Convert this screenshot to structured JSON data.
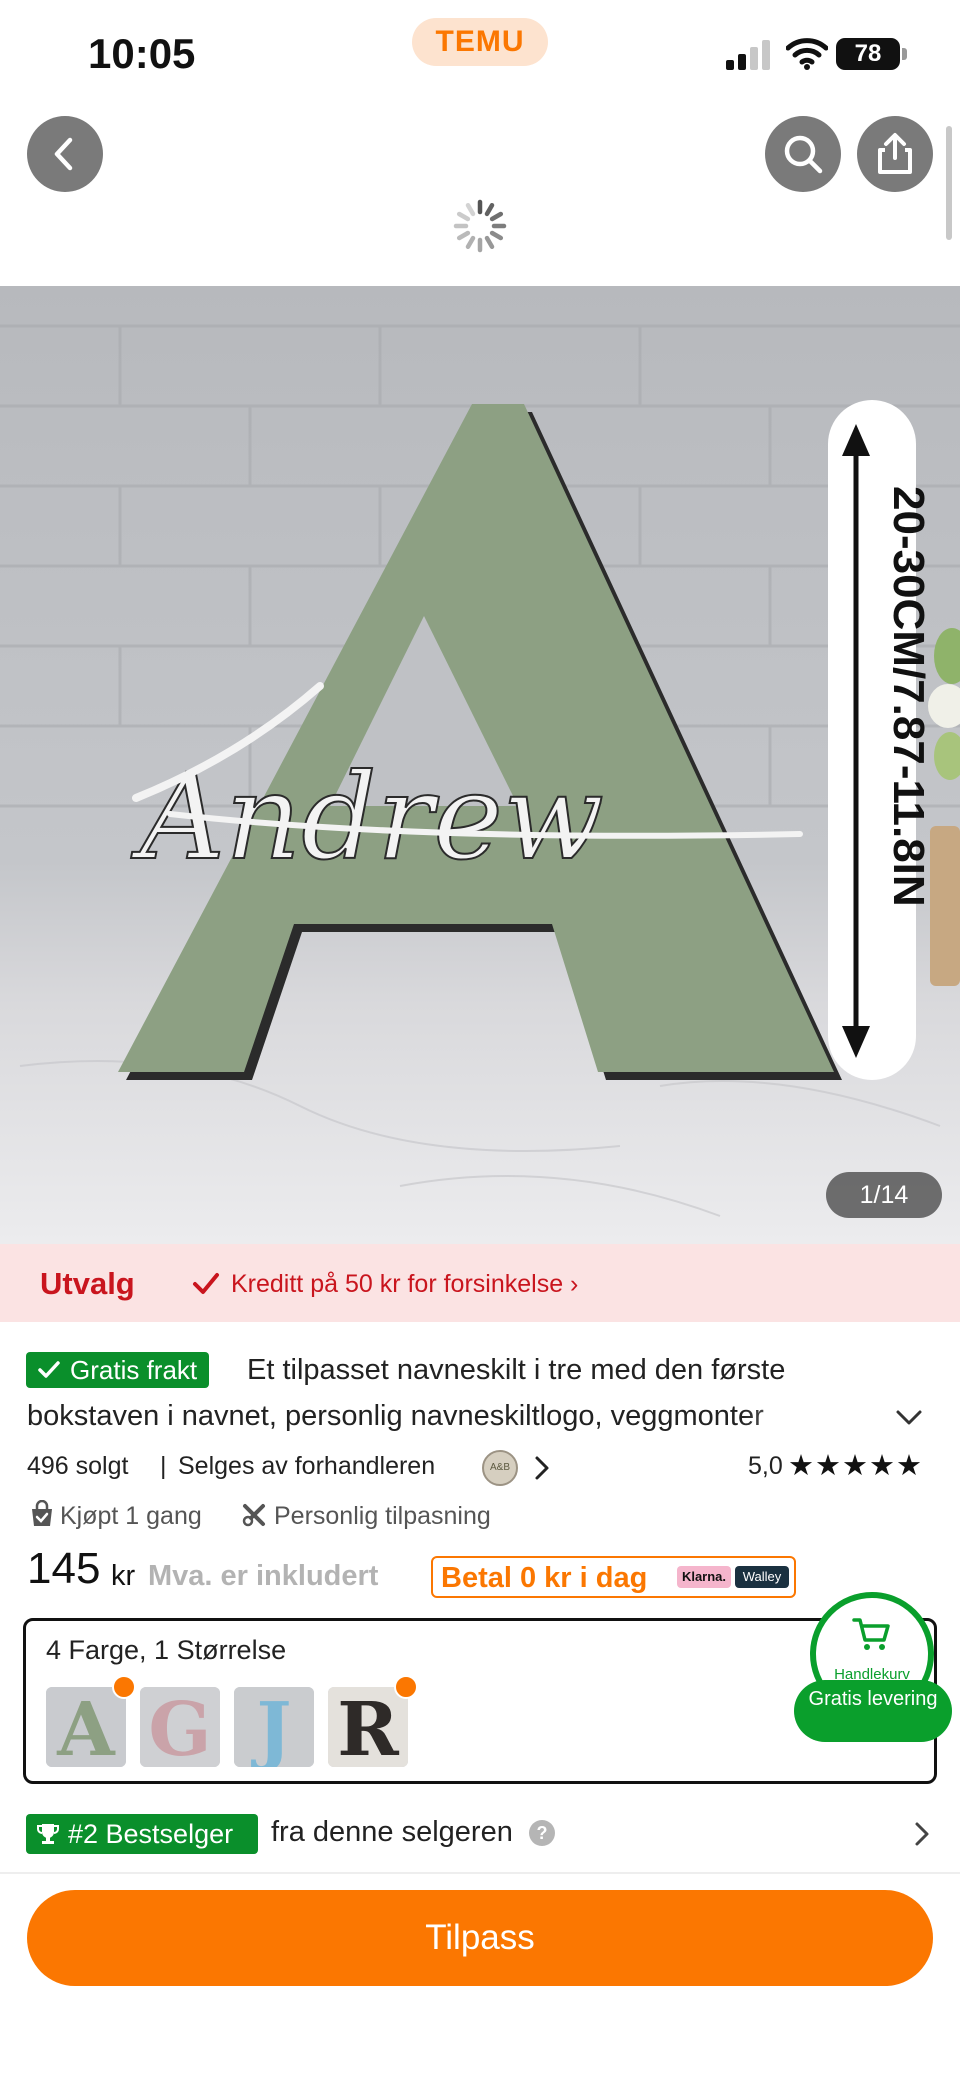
{
  "status_bar": {
    "time": "10:05",
    "app_badge": "TEMU",
    "battery": "78"
  },
  "nav": {
    "back": "back",
    "search": "search",
    "share": "share"
  },
  "hero": {
    "counter": "1/14",
    "dimension_label": "20-30CM/7.87-11.8IN",
    "name_script": "Andrew"
  },
  "banner": {
    "title": "Utvalg",
    "text": "Kreditt på 50 kr for forsinkelse ›"
  },
  "product": {
    "free_shipping": "Gratis frakt",
    "title_line1": "Et tilpasset navneskilt i tre med den første",
    "title_line2": "bokstaven i navnet, personlig navneskiltlogo, veggmonter",
    "sold": "496 solgt",
    "separator": "|",
    "seller": "Selges av forhandleren",
    "seller_avatar": "A&B",
    "rating": "5,0",
    "stars": "★★★★★",
    "bought": "Kjøpt 1 gang",
    "customization": "Personlig tilpasning",
    "price": "145",
    "price_unit": "kr",
    "vat": "Mva. er inkludert",
    "pay_later": "Betal 0 kr i dag",
    "klarna": "Klarna.",
    "walley": "Walley"
  },
  "variants": {
    "label": "4 Farge, 1 Størrelse",
    "thumbs": [
      {
        "letter": "A",
        "color": "#8da083"
      },
      {
        "letter": "G",
        "color": "#caa3a9"
      },
      {
        "letter": "J",
        "color": "#7eb8d6"
      },
      {
        "letter": "R",
        "color": "#2e2a28"
      }
    ]
  },
  "cart": {
    "label": "Handlekurv",
    "pill": "Gratis levering"
  },
  "bestseller": {
    "badge": "#2 Bestselger",
    "text": "fra denne selgeren",
    "help": "?"
  },
  "cta": {
    "label": "Tilpass"
  },
  "colors": {
    "accent": "#fb7701",
    "green": "#0a8f2b",
    "red": "#c9151e"
  }
}
